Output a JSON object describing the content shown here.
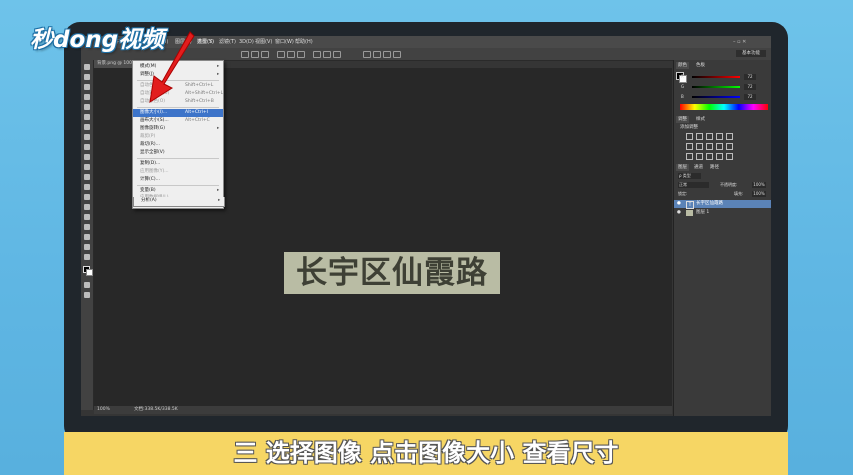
{
  "logo": {
    "text": "秒dong视频"
  },
  "menubar": {
    "items": [
      "文件(F)",
      "编辑(E)",
      "图像(I)",
      "图层(L)",
      "类型(Y)",
      "选择(S)",
      "滤镜(T)",
      "3D(D)",
      "视图(V)",
      "窗口(W)",
      "帮助(H)"
    ]
  },
  "workspace_label": "基本功能",
  "document": {
    "tab_title": "背景.png @ 100%"
  },
  "canvas_text": "长宇区仙霞路",
  "status": {
    "zoom": "100%",
    "doc_info": "文档:338.5K/338.5K"
  },
  "image_menu": {
    "items": [
      {
        "label": "模式(M)",
        "shortcut": "",
        "disabled": false,
        "highlight": false
      },
      {
        "label": "调整(J)",
        "shortcut": "",
        "disabled": false,
        "highlight": false
      },
      {
        "label": "自动色调(N)",
        "shortcut": "Shift+Ctrl+L",
        "disabled": true,
        "highlight": false
      },
      {
        "label": "自动对比度(U)",
        "shortcut": "Alt+Shift+Ctrl+L",
        "disabled": true,
        "highlight": false
      },
      {
        "label": "自动颜色(O)",
        "shortcut": "Shift+Ctrl+B",
        "disabled": true,
        "highlight": false
      },
      {
        "label": "图像大小(I)...",
        "shortcut": "Alt+Ctrl+I",
        "disabled": false,
        "highlight": true
      },
      {
        "label": "画布大小(S)...",
        "shortcut": "Alt+Ctrl+C",
        "disabled": false,
        "highlight": false
      },
      {
        "label": "图像旋转(G)",
        "shortcut": "",
        "disabled": false,
        "highlight": false
      },
      {
        "label": "裁剪(P)",
        "shortcut": "",
        "disabled": true,
        "highlight": false
      },
      {
        "label": "裁切(R)...",
        "shortcut": "",
        "disabled": false,
        "highlight": false
      },
      {
        "label": "显示全部(V)",
        "shortcut": "",
        "disabled": false,
        "highlight": false
      },
      {
        "label": "复制(D)...",
        "shortcut": "",
        "disabled": false,
        "highlight": false
      },
      {
        "label": "应用图像(Y)...",
        "shortcut": "",
        "disabled": true,
        "highlight": false
      },
      {
        "label": "计算(C)...",
        "shortcut": "",
        "disabled": false,
        "highlight": false
      },
      {
        "label": "变量(B)",
        "shortcut": "",
        "disabled": false,
        "highlight": false
      },
      {
        "label": "应用数据组(L)...",
        "shortcut": "",
        "disabled": true,
        "highlight": false
      },
      {
        "label": "陷印(T)...",
        "shortcut": "",
        "disabled": true,
        "highlight": false
      },
      {
        "label": "分析(A)",
        "shortcut": "",
        "disabled": false,
        "highlight": false
      }
    ]
  },
  "color_panel": {
    "tabs": [
      "颜色",
      "色板"
    ],
    "channels": [
      {
        "label": "R",
        "value": "72"
      },
      {
        "label": "G",
        "value": "72"
      },
      {
        "label": "B",
        "value": "72"
      }
    ]
  },
  "adjust_panel": {
    "tabs": [
      "调整",
      "样式"
    ],
    "caption": "添加调整"
  },
  "layers_panel": {
    "tabs": [
      "图层",
      "通道",
      "路径"
    ],
    "kind": "ρ 类型",
    "blend_mode": "正常",
    "opacity_label": "不透明度:",
    "opacity": "100%",
    "lock_label": "锁定:",
    "fill_label": "填充:",
    "fill": "100%",
    "layers": [
      {
        "name": "长宇区仙霞路",
        "selected": true
      },
      {
        "name": "图层 1",
        "selected": false
      }
    ]
  },
  "subtitle": {
    "text": "三 选择图像 点击图像大小 查看尺寸"
  },
  "colors": {
    "highlight": "#3d74c9",
    "subtitle_bar": "#f6d664",
    "arrow": "#e21d1d"
  }
}
